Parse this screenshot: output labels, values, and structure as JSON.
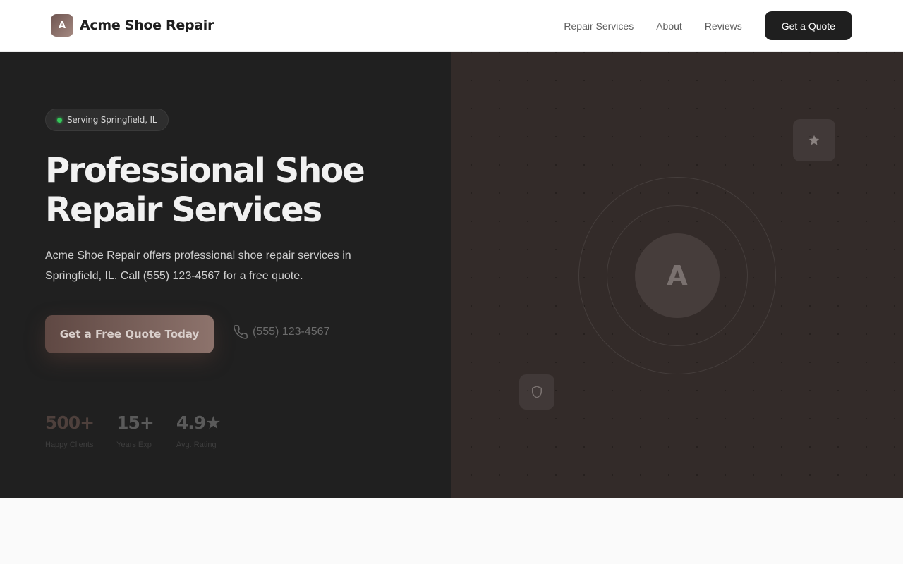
{
  "header": {
    "brand_initial": "A",
    "brand_name": "Acme Shoe Repair",
    "nav": [
      {
        "label": "Repair Services"
      },
      {
        "label": "About"
      },
      {
        "label": "Reviews"
      }
    ],
    "cta_label": "Get a Quote"
  },
  "hero": {
    "badge": "Serving Springfield, IL",
    "title_line1": "Professional Shoe",
    "title_line2": "Repair Services",
    "subtitle": "Acme Shoe Repair offers professional shoe repair services in Springfield, IL. Call (555) 123-4567 for a free quote.",
    "primary_cta": "Get a Free Quote Today",
    "phone": "(555) 123-4567",
    "stats": [
      {
        "value": "500+",
        "label": "Happy Clients"
      },
      {
        "value": "15+",
        "label": "Years Exp"
      },
      {
        "value": "4.9★",
        "label": "Avg. Rating"
      }
    ],
    "visual_letter": "A"
  },
  "icons": {
    "phone": "phone-icon",
    "star": "star-icon",
    "shield": "shield-icon"
  },
  "colors": {
    "accent": "#8d736c",
    "dark": "#202020",
    "status_green": "#34c759"
  }
}
